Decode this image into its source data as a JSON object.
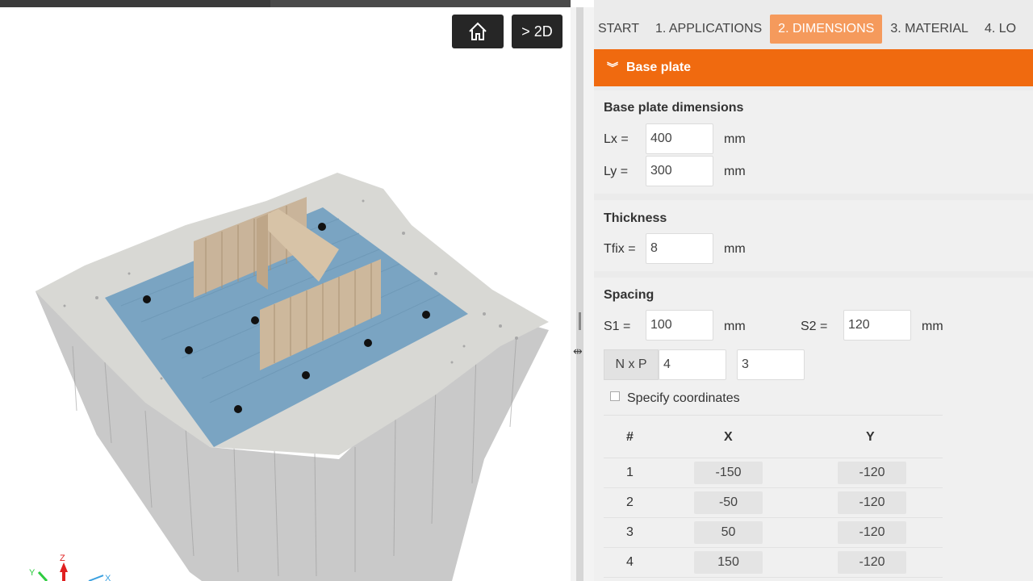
{
  "viewport": {
    "home_icon": "home-icon",
    "view_2d_label": "> 2D",
    "axis_labels": {
      "y": "Y",
      "z": "Z",
      "x": "X"
    }
  },
  "tabs": [
    {
      "label": "START",
      "active": false
    },
    {
      "label": "1. APPLICATIONS",
      "active": false
    },
    {
      "label": "2. DIMENSIONS",
      "active": true
    },
    {
      "label": "3. MATERIAL",
      "active": false
    },
    {
      "label": "4. LO",
      "active": false
    }
  ],
  "section": {
    "title": "Base plate",
    "icon": "chevron-double-down-icon",
    "accent": "#f06a0f"
  },
  "dimensions": {
    "title": "Base plate dimensions",
    "lx_label": "Lx =",
    "lx_value": "400",
    "lx_unit": "mm",
    "ly_label": "Ly =",
    "ly_value": "300",
    "ly_unit": "mm"
  },
  "thickness": {
    "title": "Thickness",
    "tfix_label": "Tfix =",
    "tfix_value": "8",
    "tfix_unit": "mm"
  },
  "spacing": {
    "title": "Spacing",
    "s1_label": "S1 =",
    "s1_value": "100",
    "s1_unit": "mm",
    "s2_label": "S2 =",
    "s2_value": "120",
    "s2_unit": "mm",
    "nxp_label": "N x P",
    "n_value": "4",
    "p_value": "3",
    "specify_coords_label": "Specify coordinates",
    "table": {
      "headers": [
        "#",
        "X",
        "Y"
      ],
      "rows": [
        {
          "idx": "1",
          "x": "-150",
          "y": "-120"
        },
        {
          "idx": "2",
          "x": "-50",
          "y": "-120"
        },
        {
          "idx": "3",
          "x": "50",
          "y": "-120"
        },
        {
          "idx": "4",
          "x": "150",
          "y": "-120"
        }
      ]
    }
  }
}
